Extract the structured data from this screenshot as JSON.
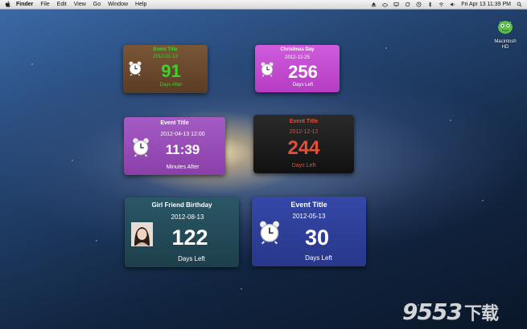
{
  "menubar": {
    "items": [
      "Finder",
      "File",
      "Edit",
      "View",
      "Go",
      "Window",
      "Help"
    ],
    "clock": "Fri Apr 13  11:39 PM"
  },
  "desktop_icons": [
    {
      "label_line1": "Macintosh",
      "label_line2": "HD"
    }
  ],
  "widgets": {
    "w1": {
      "title": "Event Title",
      "date": "2012-01-13",
      "number": "91",
      "caption": "Days After"
    },
    "w2": {
      "title": "Christmas Day",
      "date": "2012-12-25",
      "number": "256",
      "caption": "Days Left"
    },
    "w3": {
      "title": "Event Title",
      "date": "2012-04-13 12:00",
      "number": "11:39",
      "caption": "Minutes After"
    },
    "w4": {
      "title": "Event Title",
      "date": "2012-12-12",
      "number": "244",
      "caption": "Days Left"
    },
    "w5": {
      "title": "Girl Friend Birthday",
      "date": "2012-08-13",
      "number": "122",
      "caption": "Days Left"
    },
    "w6": {
      "title": "Event Title",
      "date": "2012-05-13",
      "number": "30",
      "caption": "Days Left"
    }
  },
  "colors": {
    "w1_bg": "#6b4a2e",
    "w1_accent": "#39d42c",
    "w2_bg": "#c34fd0",
    "w3_bg": "#9a4fb8",
    "w4_bg": "#1c1c1c",
    "w4_accent": "#e0503a",
    "w5_bg": "#234a58",
    "w6_bg": "#2f3f9a"
  },
  "watermark": {
    "text": "9553",
    "cn": "下载"
  }
}
